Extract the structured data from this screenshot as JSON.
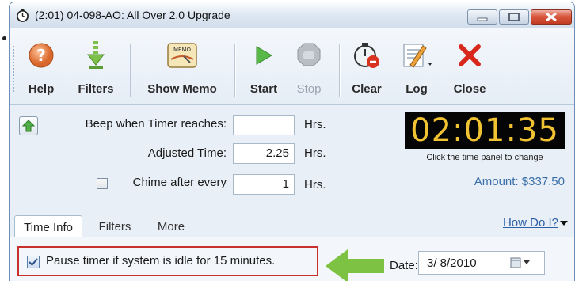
{
  "window": {
    "title": "(2:01) 04-098-AO: All Over 2.0 Upgrade"
  },
  "toolbar": {
    "help_label": "Help",
    "filters_label": "Filters",
    "show_memo_label": "Show Memo",
    "memo_icon_text": "MEMO",
    "start_label": "Start",
    "stop_label": "Stop",
    "clear_label": "Clear",
    "log_label": "Log",
    "close_label": "Close"
  },
  "timer": {
    "beep_label": "Beep when Timer reaches:",
    "beep_value": "",
    "beep_unit": "Hrs.",
    "adjusted_label": "Adjusted Time:",
    "adjusted_value": "2.25",
    "adjusted_unit": "Hrs.",
    "chime_label": "Chime after every",
    "chime_checked": false,
    "chime_value": "1",
    "chime_unit": "Hrs.",
    "clock_display": "02:01:35",
    "clock_hint": "Click the time panel to change",
    "amount": "Amount: $337.50"
  },
  "tabs": {
    "items": [
      "Time Info",
      "Filters",
      "More"
    ],
    "active": "Time Info",
    "help_link": "How Do I?"
  },
  "time_info": {
    "pause_label": "Pause timer if system is idle for 15 minutes.",
    "pause_checked": true,
    "date_label": "Date:",
    "date_value": "3/ 8/2010"
  },
  "colors": {
    "clock_bg": "#050505",
    "clock_fg": "#f1c232",
    "highlight_border": "#c9302c",
    "arrow_green": "#7dc242",
    "amount_text": "#3a6ea8",
    "link": "#2c5fa5"
  },
  "icons": [
    "clock-icon",
    "help-icon",
    "filter-icon",
    "memo-icon",
    "play-icon",
    "stop-icon",
    "clear-timer-icon",
    "log-icon",
    "close-x-icon",
    "up-arrow-icon",
    "calendar-icon"
  ]
}
